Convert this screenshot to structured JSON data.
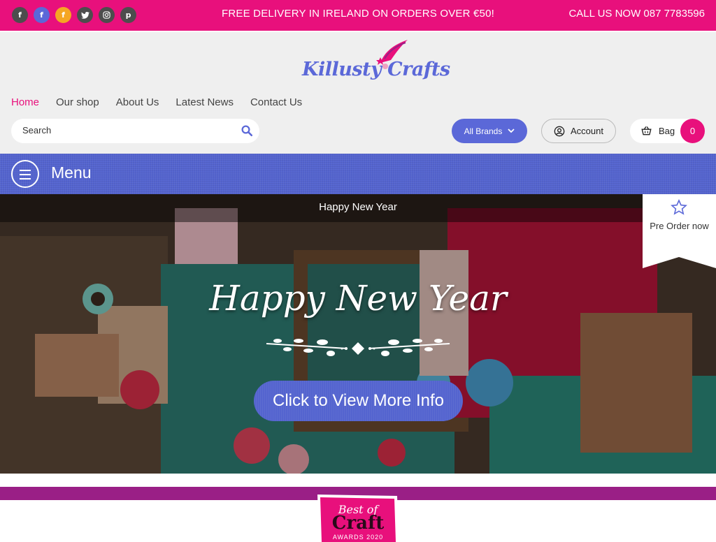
{
  "topbar": {
    "social": [
      {
        "name": "facebook",
        "glyph": "f",
        "color": "#4d4d4d"
      },
      {
        "name": "facebook",
        "glyph": "f",
        "color": "#5b68d8"
      },
      {
        "name": "facebook",
        "glyph": "f",
        "color": "#f5a623"
      },
      {
        "name": "twitter",
        "glyph": "t",
        "color": "#4d4d4d"
      },
      {
        "name": "instagram",
        "glyph": "o",
        "color": "#4d4d4d"
      },
      {
        "name": "pinterest",
        "glyph": "p",
        "color": "#4d4d4d"
      }
    ],
    "promo": "FREE DELIVERY IN IRELAND ON ORDERS OVER €50!",
    "phone": "CALL US NOW 087 7783596"
  },
  "header": {
    "logo_text": "Killusty Crafts",
    "nav": [
      {
        "label": "Home",
        "active": true
      },
      {
        "label": "Our shop",
        "active": false
      },
      {
        "label": "About Us",
        "active": false
      },
      {
        "label": "Latest News",
        "active": false
      },
      {
        "label": "Contact Us",
        "active": false
      }
    ],
    "search_placeholder": "Search",
    "brands_label": "All Brands",
    "account_label": "Account",
    "bag_label": "Bag",
    "bag_count": "0"
  },
  "menubar": {
    "label": "Menu"
  },
  "hero": {
    "top_title": "Happy New Year",
    "script_title": "Happy New Year",
    "cta_label": "Click to View More Info"
  },
  "preorder": {
    "label": "Pre Order now"
  },
  "badge": {
    "line1": "Best of",
    "line2": "Craft",
    "line3": "AWARDS 2020"
  },
  "colors": {
    "brand_pink": "#e8107c",
    "brand_blue": "#5b68d8",
    "menu_blue": "#5464cf",
    "band_purple": "#9a1f86"
  }
}
